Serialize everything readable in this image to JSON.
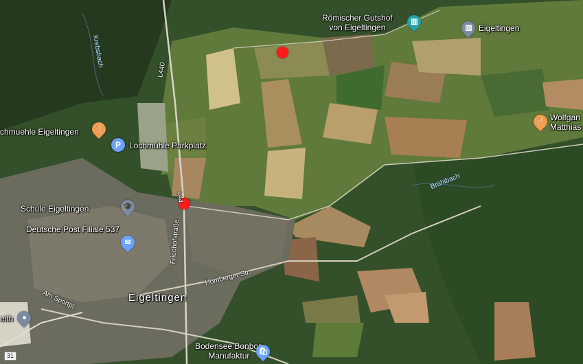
{
  "map": {
    "places": {
      "roemischer": "Römischer Gutshof\nvon Eigeltingen",
      "eigeltingen_top": "Eigeltingen",
      "lochmuehle": "chmuehle Eigeltingen",
      "parkplatz": "Lochmühle Parkplatz",
      "schule": "Schule Eigeltingen",
      "post": "Deutsche Post Filiale 537",
      "town": "Eigeltingen",
      "wolfgang": "Wolfgan\nMatthias",
      "bonbon": "Bodensee Bonbon\nManufaktur",
      "leith": "eith"
    },
    "roads": {
      "l440_north": "L440",
      "l440_south": "L44",
      "friedhof": "Friedhofstraße",
      "homberger": "Homberger Str.",
      "sportpl": "Am Sportpl",
      "shield31": "31"
    },
    "water": {
      "krebsbach": "Krebsbach",
      "bruehlbach": "Brühlbach"
    },
    "icons": {
      "museum": "museum-icon",
      "landmark": "landmark-icon",
      "restaurant": "restaurant-icon",
      "parking": "parking-icon",
      "school": "school-icon",
      "mail": "mail-icon",
      "shopping": "shopping-bag-icon",
      "pin": "location-pin-icon"
    },
    "markers": [
      "red-dot-marker",
      "red-dot-marker"
    ]
  }
}
